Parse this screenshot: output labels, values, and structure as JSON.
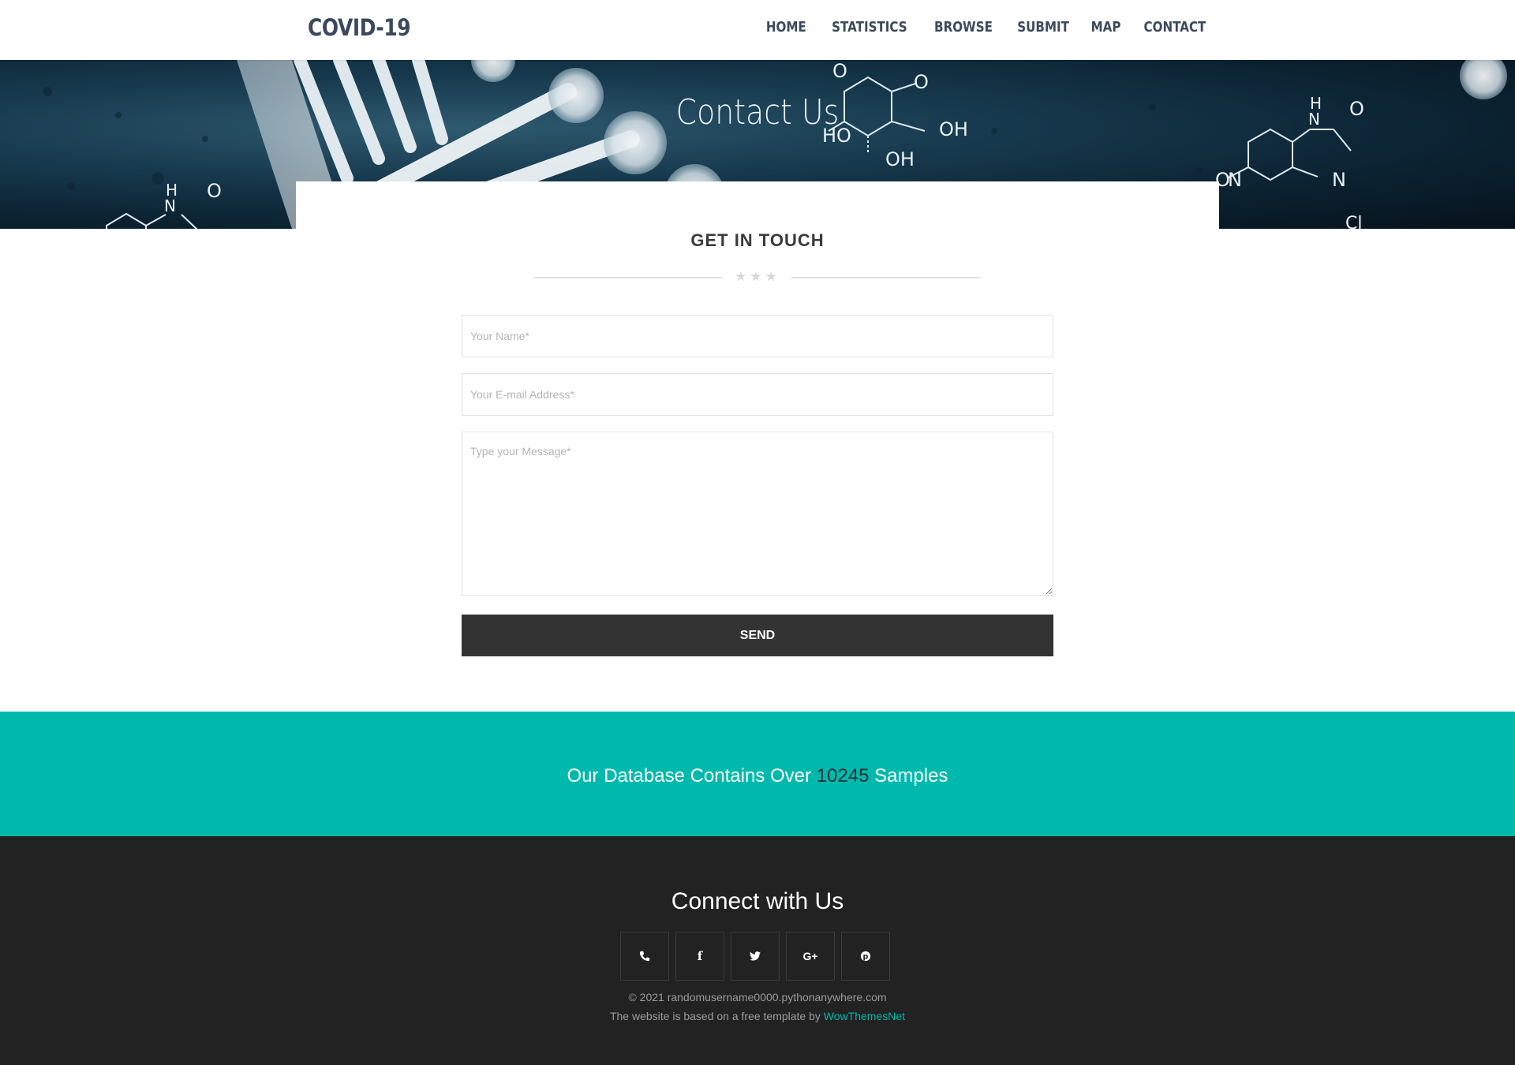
{
  "header": {
    "brand": "COVID-19",
    "nav": [
      "HOME",
      "STATISTICS",
      "BROWSE",
      "SUBMIT",
      "MAP",
      "CONTACT"
    ]
  },
  "hero": {
    "title": "Contact Us"
  },
  "contact": {
    "section_title": "GET IN TOUCH",
    "name_placeholder": "Your Name*",
    "email_placeholder": "Your E-mail Address*",
    "message_placeholder": "Type your Message*",
    "send_label": "SEND"
  },
  "banner": {
    "prefix": "Our Database Contains Over",
    "count": "10245",
    "suffix": "Samples"
  },
  "footer": {
    "title": "Connect with Us",
    "socials": [
      "phone-icon",
      "facebook-icon",
      "twitter-icon",
      "google-plus-icon",
      "pinterest-icon"
    ],
    "copyright": "© 2021 randomusername0000.pythonanywhere.com",
    "credit_prefix": "The website is based on a free template by",
    "credit_link": "WowThemesNet"
  },
  "colors": {
    "accent_teal": "#00b9ad",
    "nav_text": "#3a4a5c",
    "footer_bg": "#222222",
    "button_bg": "#333333"
  }
}
